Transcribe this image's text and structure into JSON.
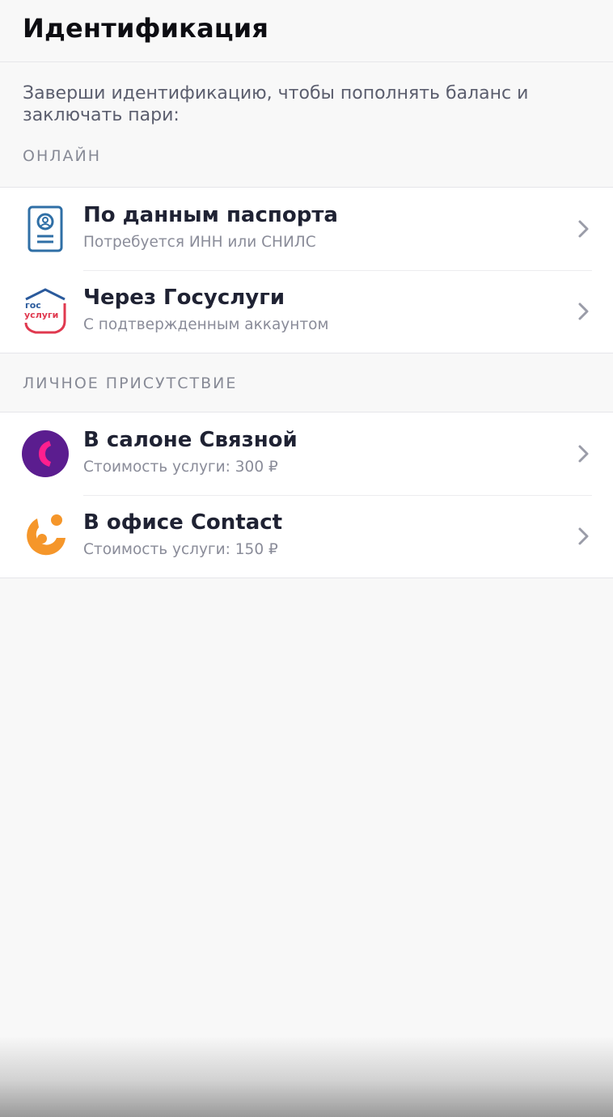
{
  "header": {
    "title": "Идентификация"
  },
  "intro": {
    "text": "Заверши идентификацию, чтобы пополнять баланс и заключать пари:"
  },
  "sections": [
    {
      "label": "ОНЛАЙН",
      "items": [
        {
          "title": "По данным паспорта",
          "subtitle": "Потребуется ИНН или СНИЛС",
          "icon": "passport-icon"
        },
        {
          "title": "Через Госуслуги",
          "subtitle": "С подтвержденным аккаунтом",
          "icon": "gosuslugi-icon",
          "icon_text_1": "гос",
          "icon_text_2": "услуги"
        }
      ]
    },
    {
      "label": "ЛИЧНОЕ ПРИСУТСТВИЕ",
      "items": [
        {
          "title": "В салоне Связной",
          "subtitle": "Стоимость услуги: 300 ₽",
          "icon": "svyaznoy-icon"
        },
        {
          "title": "В офисе Contact",
          "subtitle": "Стоимость услуги: 150 ₽",
          "icon": "contact-icon"
        }
      ]
    }
  ],
  "colors": {
    "passport_blue": "#2f6fa6",
    "gos_blue": "#2a5a9c",
    "gos_red": "#e0394f",
    "svyaznoy_purple": "#5b1d8f",
    "svyaznoy_pink": "#ff1f8e",
    "contact_orange": "#f5962a"
  }
}
